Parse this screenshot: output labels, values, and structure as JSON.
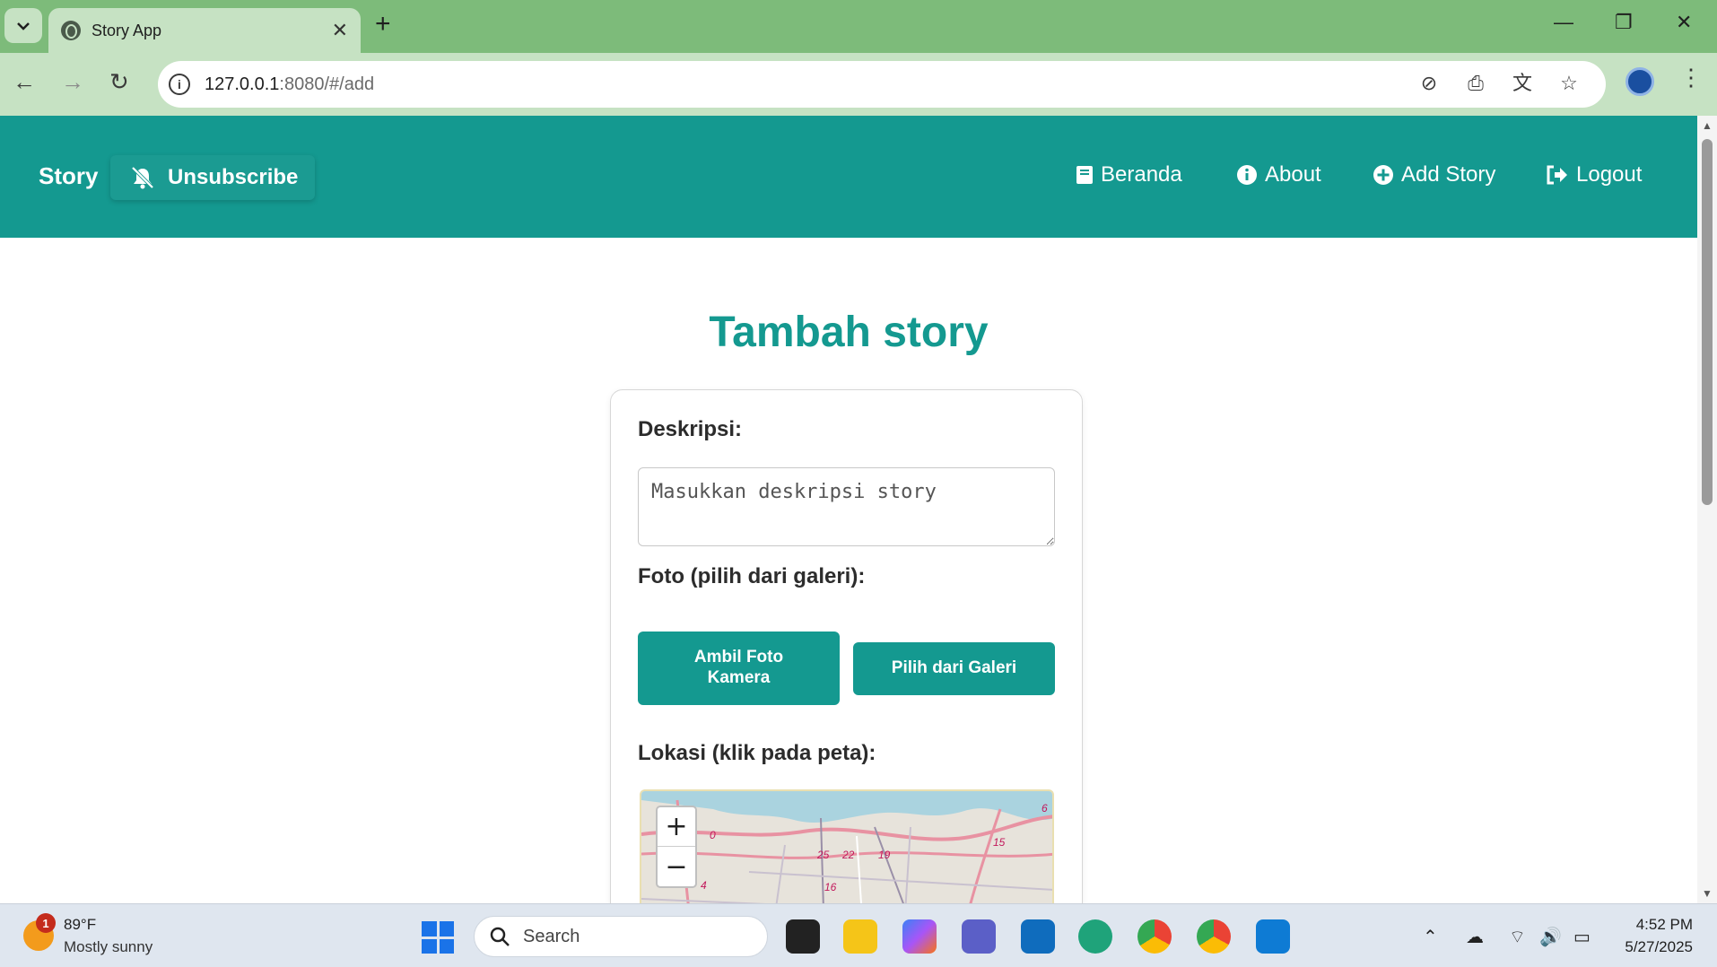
{
  "browser": {
    "tab_title": "Story App",
    "url_host": "127.0.0.1",
    "url_path": ":8080/#/add",
    "new_tab_label": "+"
  },
  "header": {
    "brand": "Story",
    "unsubscribe_label": "Unsubscribe",
    "nav": [
      {
        "label": "Beranda",
        "icon": "book-icon"
      },
      {
        "label": "About",
        "icon": "info-circle-icon"
      },
      {
        "label": "Add Story",
        "icon": "plus-circle-icon"
      },
      {
        "label": "Logout",
        "icon": "logout-icon"
      }
    ],
    "color": "#149990"
  },
  "main": {
    "title": "Tambah story",
    "description_label": "Deskripsi:",
    "description_placeholder": "Masukkan deskripsi story",
    "description_value": "",
    "photo_label": "Foto (pilih dari galeri):",
    "camera_button": "Ambil Foto Kamera",
    "gallery_button": "Pilih dari Galeri",
    "location_label": "Lokasi (klik pada peta):",
    "map": {
      "zoom_in": "+",
      "zoom_out": "−",
      "road_labels": [
        "0",
        "25",
        "22",
        "19",
        "15",
        "6",
        "4",
        "16"
      ]
    }
  },
  "taskbar": {
    "weather_temp": "89°F",
    "weather_desc": "Mostly sunny",
    "weather_badge": "1",
    "search_label": "Search",
    "time": "4:52 PM",
    "date": "5/27/2025"
  }
}
